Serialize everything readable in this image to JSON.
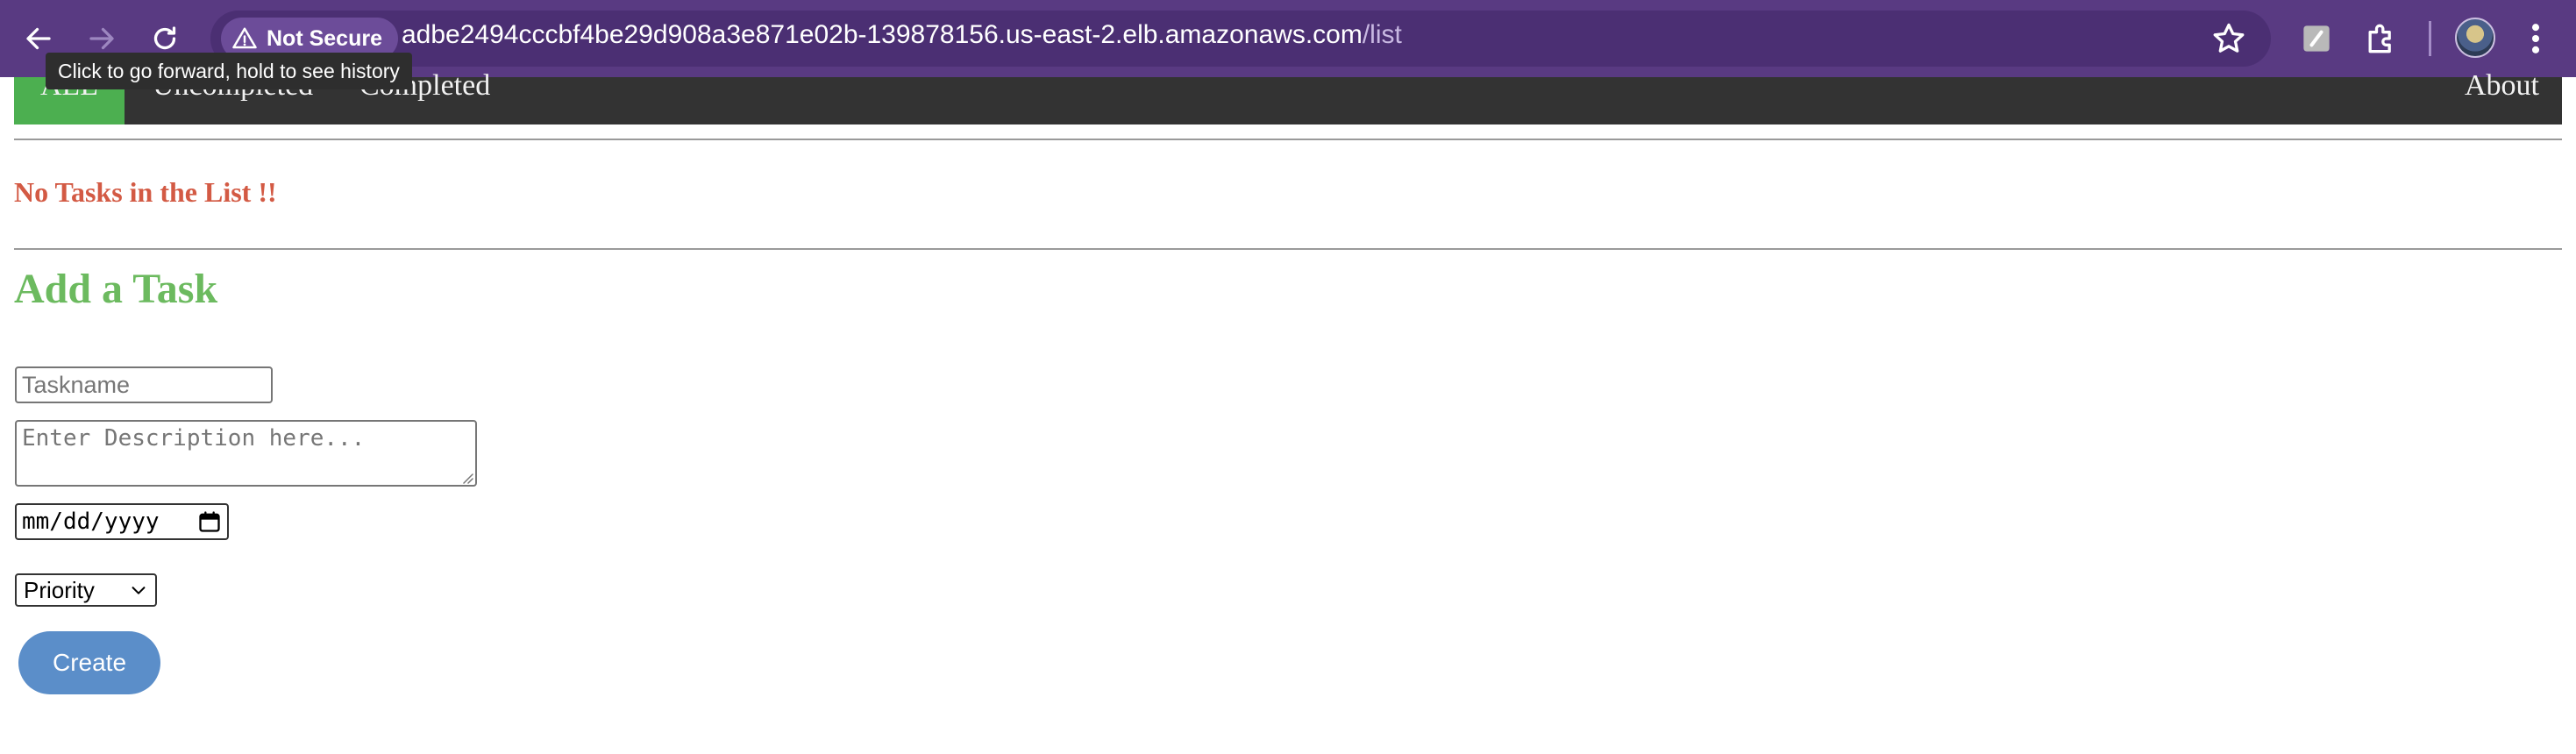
{
  "browser": {
    "security_label": "Not Secure",
    "url_host": "adbe2494cccbf4be29d908a3e871e02b-139878156.us-east-2.elb.amazonaws.com",
    "url_path": "/list",
    "tooltip": "Click to go forward, hold to see history",
    "icons": [
      "back-arrow-icon",
      "forward-arrow-icon",
      "reload-icon",
      "warning-icon",
      "star-icon",
      "extension-icon",
      "puzzle-icon",
      "profile-avatar",
      "kebab-menu-icon"
    ],
    "colors": {
      "toolbar": "#593a82",
      "omnibox": "#4b2f73"
    }
  },
  "nav": {
    "items": [
      {
        "label": "ALL",
        "active": true
      },
      {
        "label": "Uncompleted",
        "active": false
      },
      {
        "label": "Completed",
        "active": false
      }
    ],
    "about_label": "About"
  },
  "list": {
    "empty_message": "No Tasks in the List !!"
  },
  "form": {
    "title": "Add a Task",
    "taskname_placeholder": "Taskname",
    "description_placeholder": "Enter Description here...",
    "date_placeholder": "mm/dd/yyyy",
    "priority_selected": "Priority",
    "create_label": "Create"
  },
  "colors": {
    "nav_bg": "#333333",
    "nav_active": "#4caf50",
    "empty_message": "#d35a44",
    "form_title": "#6cba5f",
    "create_button": "#5b8ec9"
  }
}
